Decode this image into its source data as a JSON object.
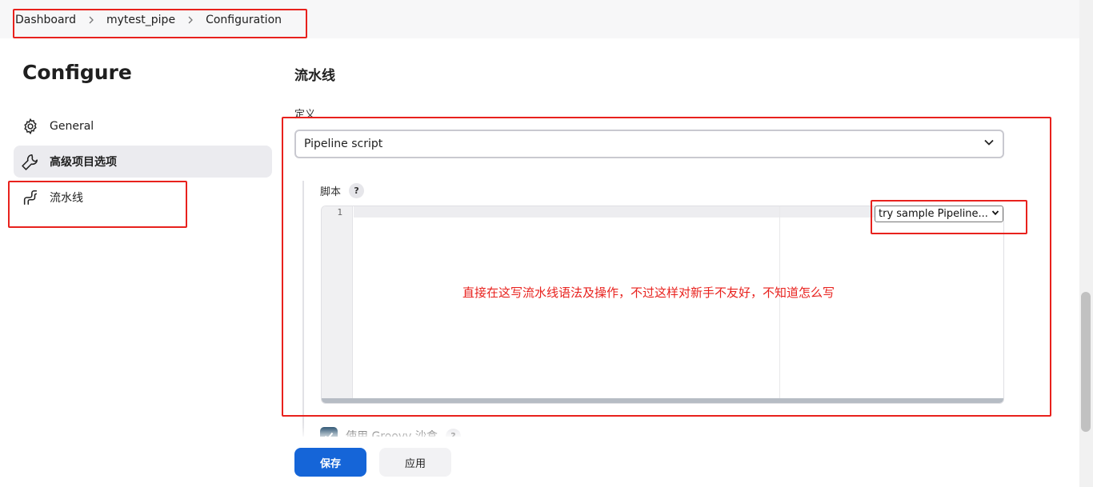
{
  "breadcrumb": {
    "items": [
      "Dashboard",
      "mytest_pipe",
      "Configuration"
    ]
  },
  "sidebar": {
    "title": "Configure",
    "items": [
      {
        "label": "General",
        "icon": "gear-icon"
      },
      {
        "label": "高级项目选项",
        "icon": "wrench-icon"
      },
      {
        "label": "流水线",
        "icon": "pipeline-icon"
      }
    ]
  },
  "main": {
    "section_title": "流水线",
    "definition_label": "定义",
    "definition_value": "Pipeline script",
    "script_label": "脚本",
    "help_glyph": "?",
    "editor": {
      "line_number": "1",
      "sample_select_value": "try sample Pipeline..."
    },
    "annotation_text": "直接在这写流水线语法及操作，不过这样对新手不友好，不知道怎么写",
    "sandbox_label": "使用 Groovy 沙盒"
  },
  "buttons": {
    "save": "保存",
    "apply": "应用"
  },
  "colors": {
    "annotation_red": "#e8211d",
    "primary_blue": "#1565d8",
    "active_nav_bg": "#ebebef",
    "checkbox": "#113e5f"
  }
}
